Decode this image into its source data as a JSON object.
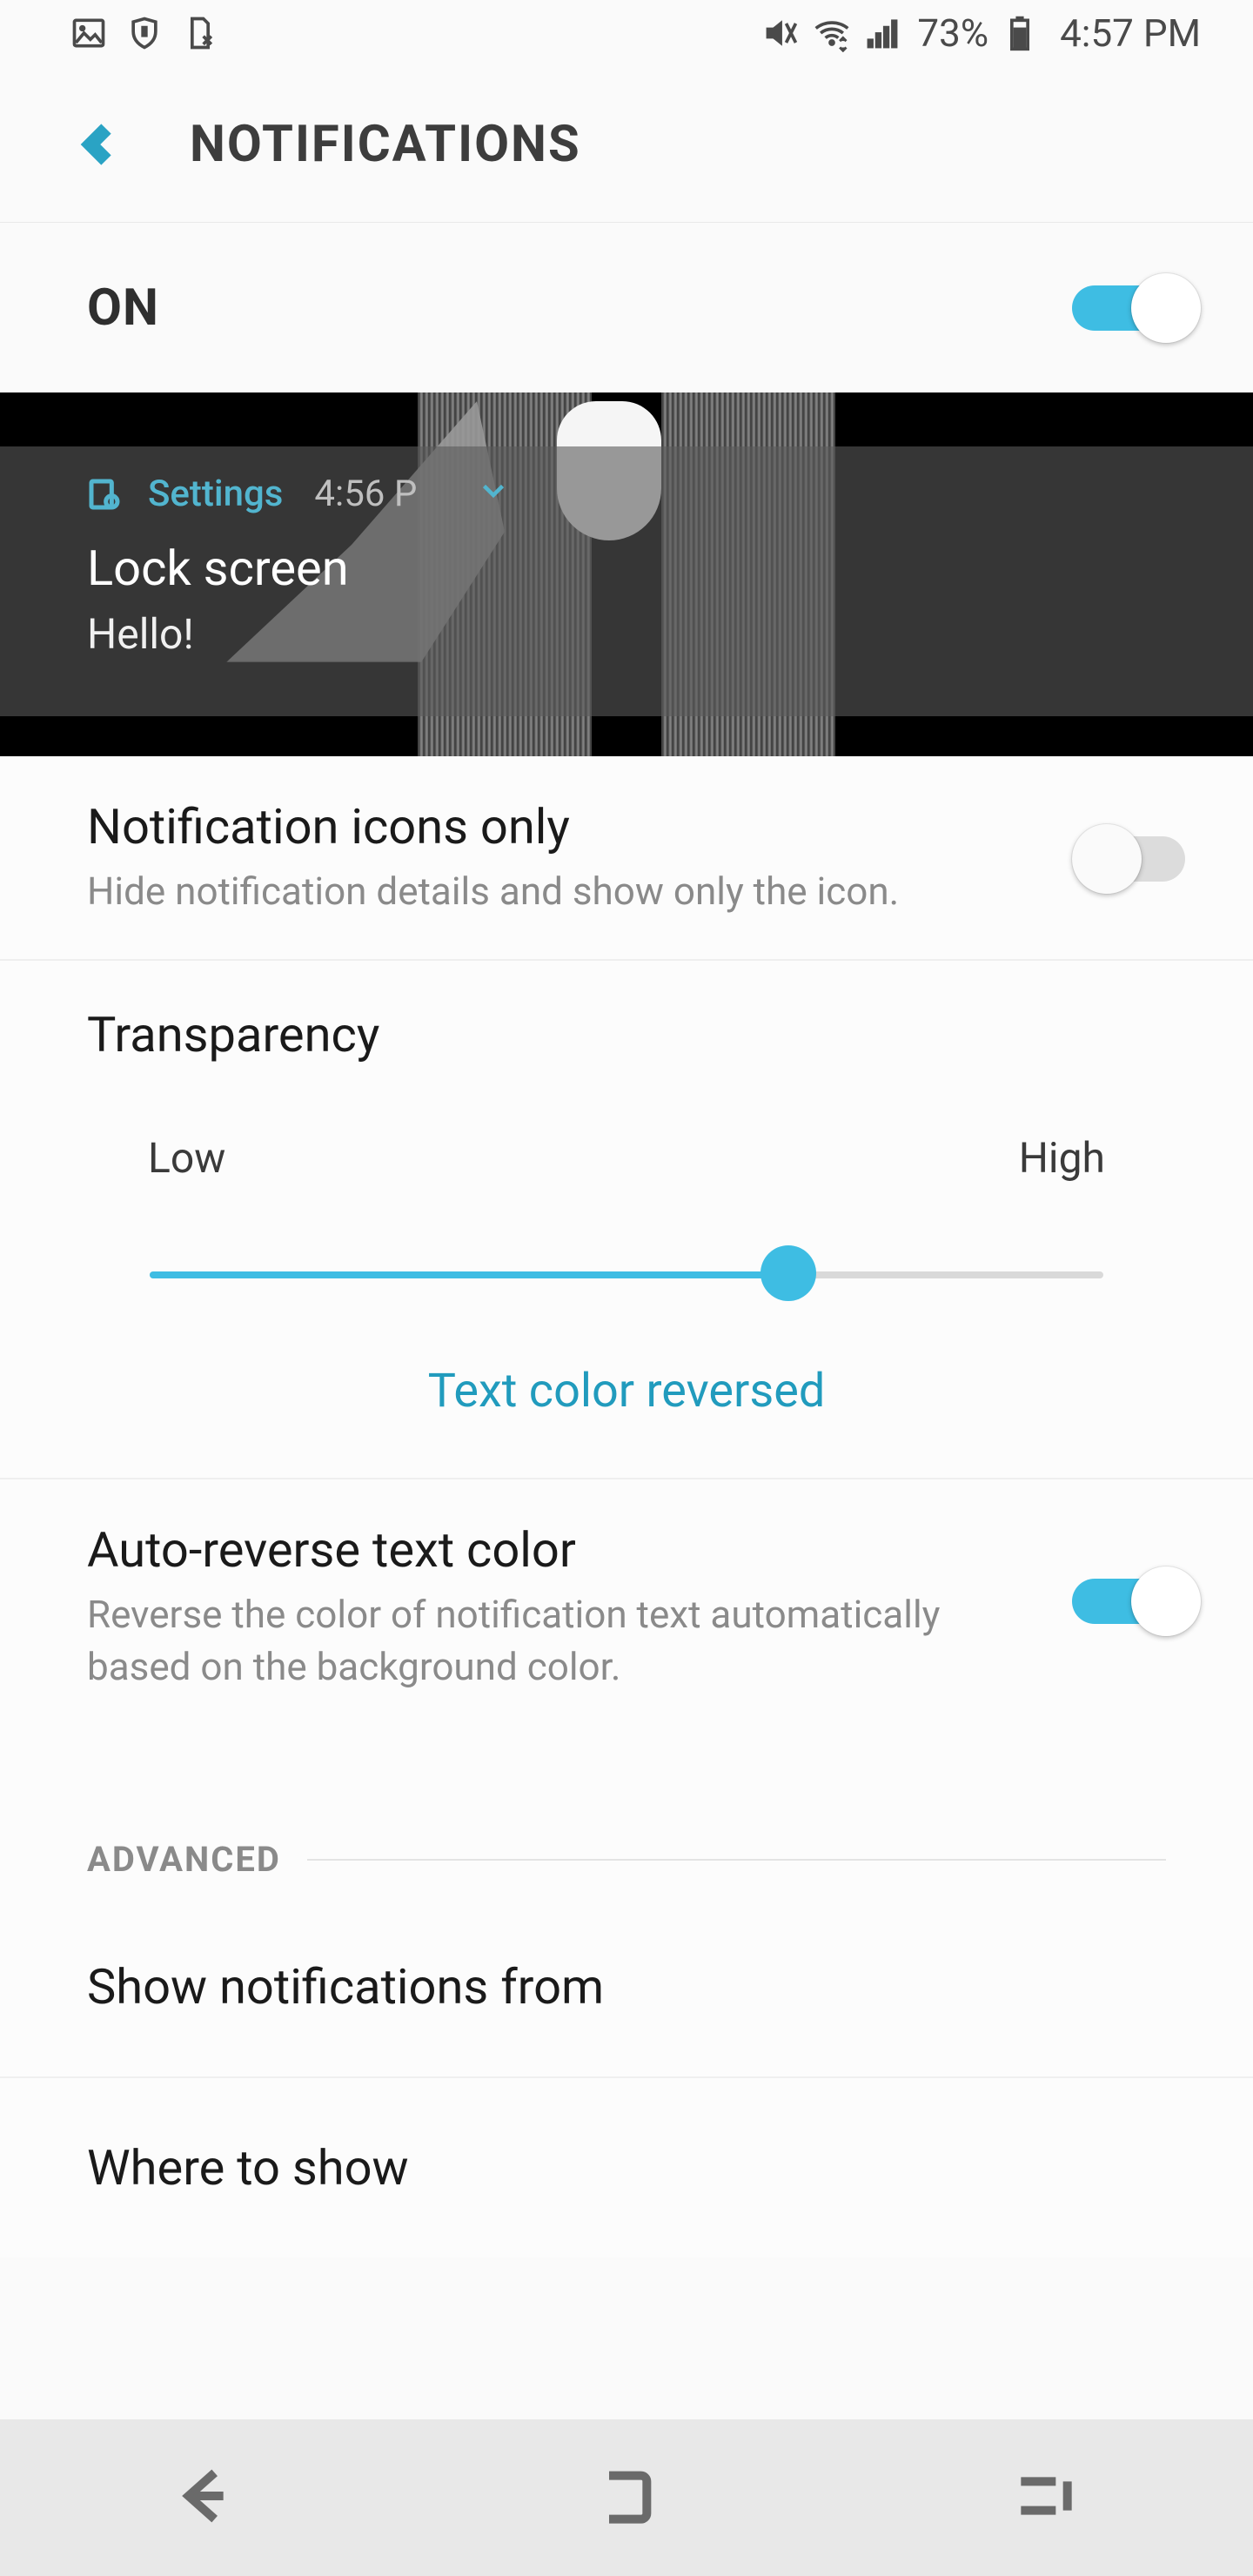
{
  "status": {
    "battery_pct": "73%",
    "time": "4:57 PM"
  },
  "header": {
    "title": "NOTIFICATIONS"
  },
  "master": {
    "label": "ON",
    "on": true
  },
  "preview": {
    "app": "Settings",
    "time": "4:56 P",
    "title": "Lock screen",
    "body": "Hello!"
  },
  "icons_only": {
    "title": "Notification icons only",
    "desc": "Hide notification details and show only the icon.",
    "on": false
  },
  "transparency": {
    "title": "Transparency",
    "low": "Low",
    "high": "High",
    "value_pct": 67,
    "link": "Text color reversed"
  },
  "auto_reverse": {
    "title": "Auto-reverse text color",
    "desc": "Reverse the color of notification text automatically based on the background color.",
    "on": true
  },
  "advanced": {
    "label": "ADVANCED",
    "show_from": "Show notifications from",
    "where": "Where to show"
  }
}
